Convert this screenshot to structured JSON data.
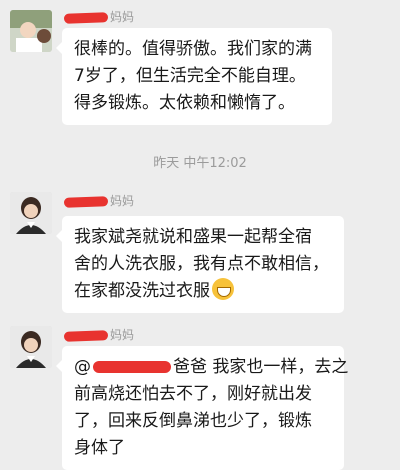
{
  "messages": [
    {
      "sender_suffix": "妈妈",
      "lines": [
        "很棒的。值得骄傲。我们家的满",
        "7岁了，但生活完全不能自理。",
        "得多锻炼。太依赖和懒惰了。"
      ]
    },
    {
      "timestamp": "昨天 中午12:02"
    },
    {
      "sender_suffix": "妈妈",
      "lines": [
        "我家斌尧就说和盛果一起帮全宿",
        "舍的人洗衣服，我有点不敢相信，",
        "在家都没洗过衣服"
      ]
    },
    {
      "sender_suffix": "妈妈",
      "mention_prefix": "@",
      "mention_suffix": "爸爸  我家也一样，去之",
      "lines": [
        "前高烧还怕去不了，刚好就出发",
        "了，回来反倒鼻涕也少了，锻炼",
        "身体了"
      ]
    }
  ]
}
